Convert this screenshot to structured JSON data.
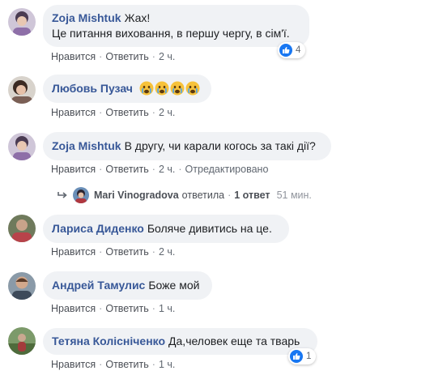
{
  "comments": [
    {
      "author": "Zoja Mishtuk",
      "lines": [
        "Жах!",
        "Це питання виховання, в першу чергу, в сім'ї."
      ],
      "actions": {
        "like": "Нравится",
        "reply": "Ответить",
        "time": "2 ч."
      },
      "reaction_count": "4"
    },
    {
      "author": "Любовь Пузач",
      "emoji_count": 4,
      "emoji": "crying-face",
      "actions": {
        "like": "Нравится",
        "reply": "Ответить",
        "time": "2 ч."
      }
    },
    {
      "author": "Zoja Mishtuk",
      "text": "В другу, чи карали когось за такі дії?",
      "actions": {
        "like": "Нравится",
        "reply": "Ответить",
        "time": "2 ч.",
        "edited": "Отредактировано"
      },
      "reply_summary": {
        "name": "Mari Vinogradova",
        "verb": "ответила",
        "count": "1 ответ",
        "time": "51 мин."
      }
    },
    {
      "author": "Лариса Диденко",
      "text": "Боляче дивитись на це.",
      "actions": {
        "like": "Нравится",
        "reply": "Ответить",
        "time": "2 ч."
      }
    },
    {
      "author": "Андрей Тамулис",
      "text": "Боже мой",
      "actions": {
        "like": "Нравится",
        "reply": "Ответить",
        "time": "1 ч."
      }
    },
    {
      "author": "Тетяна Колісніченко",
      "text": "Да,человек еще та тварь",
      "actions": {
        "like": "Нравится",
        "reply": "Ответить",
        "time": "1 ч."
      },
      "reaction_count": "1"
    }
  ],
  "colors": {
    "author": "#385898",
    "bubble": "#f0f2f5",
    "like_blue": "#1877f2",
    "meta": "#606770"
  }
}
